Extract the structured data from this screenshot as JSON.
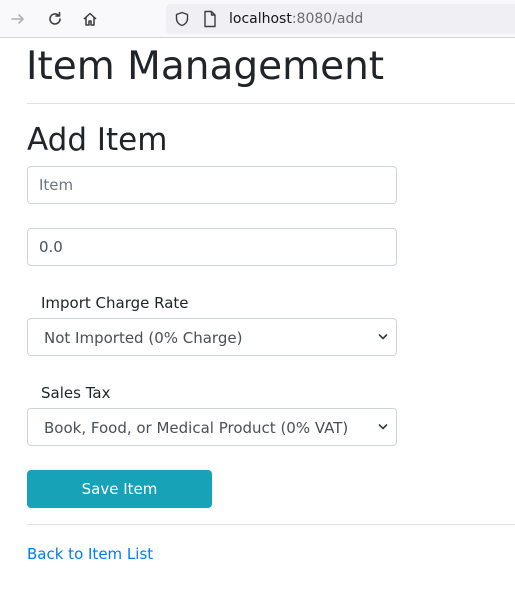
{
  "browser": {
    "url_host": "localhost",
    "url_path": ":8080/add"
  },
  "page": {
    "title": "Item Management",
    "subtitle": "Add Item"
  },
  "form": {
    "item_placeholder": "Item",
    "item_value": "",
    "price_value": "0.0",
    "import_label": "Import Charge Rate",
    "import_selected": "Not Imported (0% Charge)",
    "sales_tax_label": "Sales Tax",
    "sales_tax_selected": "Book, Food, or Medical Product (0% VAT)",
    "save_label": "Save Item"
  },
  "footer": {
    "back_link": "Back to Item List"
  },
  "colors": {
    "primary_button": "#17a2b8",
    "link": "#007bff"
  }
}
